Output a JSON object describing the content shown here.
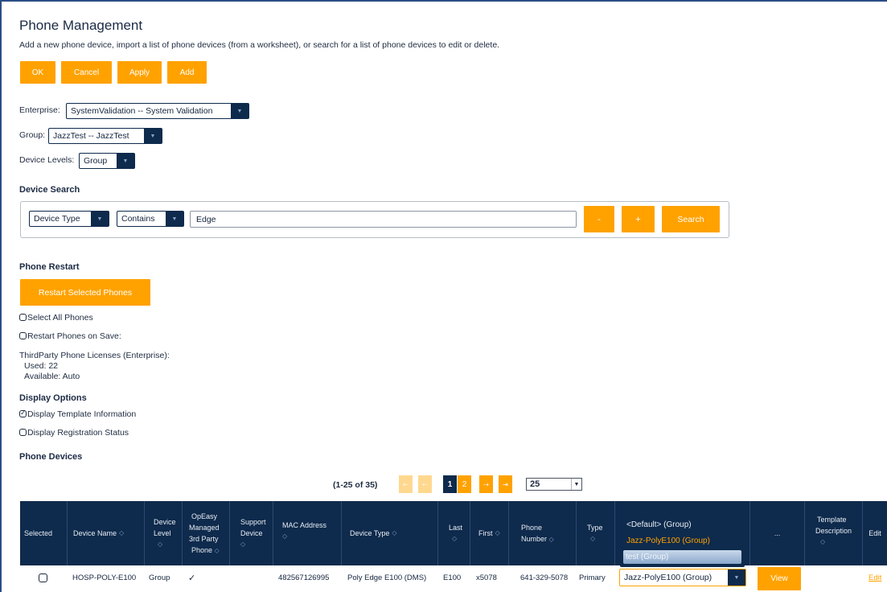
{
  "page": {
    "title": "Phone Management",
    "subtitle": "Add a new phone device, import a list of phone devices (from a worksheet), or search for a list of phone devices to edit or delete."
  },
  "toolbar": {
    "ok": "OK",
    "cancel": "Cancel",
    "apply": "Apply",
    "add": "Add"
  },
  "filters": {
    "enterprise_label": "Enterprise:",
    "enterprise_value": "SystemValidation -- System Validation",
    "group_label": "Group:",
    "group_value": "JazzTest -- JazzTest",
    "device_levels_label": "Device Levels:",
    "device_levels_value": "Group"
  },
  "device_search": {
    "heading": "Device Search",
    "field": "Device Type",
    "operator": "Contains",
    "value": "Edge",
    "minus": "-",
    "plus": "+",
    "search": "Search"
  },
  "phone_restart": {
    "heading": "Phone Restart",
    "restart_button": "Restart Selected Phones",
    "select_all": "Select All Phones",
    "select_all_checked": false,
    "restart_on_save": "Restart Phones on Save:",
    "restart_on_save_checked": false,
    "licenses_label": "ThirdParty Phone Licenses (Enterprise):",
    "used": "Used:  22",
    "available": "Available:  Auto"
  },
  "display_options": {
    "heading": "Display Options",
    "template_info": "Display Template Information",
    "template_info_checked": true,
    "registration_status": "Display Registration Status",
    "registration_status_checked": false
  },
  "phone_devices": {
    "heading": "Phone Devices",
    "range": "(1-25 of 35)",
    "pages": [
      "1",
      "2"
    ],
    "current_page": "1",
    "page_size": "25",
    "nav_first": "⇤",
    "nav_prev": "⇠",
    "nav_next": "⇢",
    "nav_last": "⇥"
  },
  "table": {
    "headers": {
      "selected": "Selected",
      "device_name": "Device Name",
      "device_level_1": "Device",
      "device_level_2": "Level",
      "opeasy_1": "OpEasy",
      "opeasy_2": "Managed",
      "opeasy_3": "3rd Party",
      "opeasy_4": "Phone",
      "support_1": "Support",
      "support_2": "Device",
      "mac": "MAC Address",
      "device_type": "Device Type",
      "last": "Last",
      "first": "First",
      "phone_1": "Phone",
      "phone_2": "Number",
      "type": "Type",
      "ellipsis": "...",
      "template_1": "Template",
      "template_2": "Description",
      "edit": "Edit"
    },
    "sort_icon": "◇",
    "template_options": [
      "<Default> (Group)",
      "Jazz-PolyE100 (Group)",
      "test (Group)"
    ],
    "rows": [
      {
        "selected": false,
        "device_name": "HOSP-POLY-E100",
        "device_level": "Group",
        "opeasy_managed": "✓",
        "mac": "482567126995",
        "device_type": "Poly Edge E100 (DMS)",
        "last": "E100",
        "first": "x5078",
        "phone_number": "641-329-5078",
        "type": "Primary",
        "template": "Jazz-PolyE100 (Group)",
        "view": "View",
        "edit": "Edit"
      }
    ]
  },
  "colors": {
    "accent": "#ffa200",
    "navy": "#0e2a4c",
    "frame": "#2a4e86"
  }
}
